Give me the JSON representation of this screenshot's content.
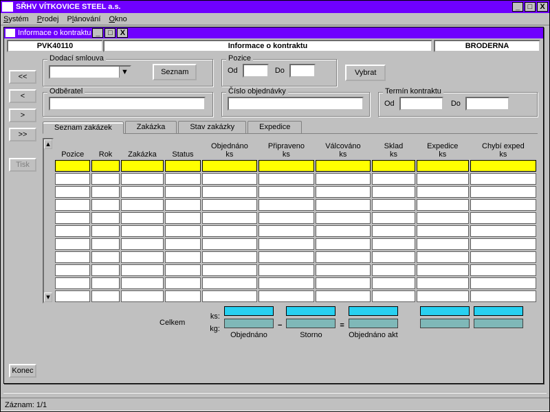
{
  "window": {
    "title": "SŘHV VÍTKOVICE STEEL a.s.",
    "menu": [
      "Systém",
      "Prodej",
      "Plánování",
      "Okno"
    ],
    "status": "Záznam: 1/1"
  },
  "internal": {
    "title": "Informace o kontraktu",
    "left_code": "PVK40110",
    "center_title": "Informace o kontraktu",
    "right_code": "BRODERNA"
  },
  "nav_buttons": [
    "<<",
    "<",
    ">",
    ">>"
  ],
  "tisk_label": "Tisk",
  "konec_label": "Konec",
  "groupboxes": {
    "dodaci": {
      "legend": "Dodací smlouva",
      "seznam_btn": "Seznam"
    },
    "pozice": {
      "legend": "Pozice",
      "od_label": "Od",
      "do_label": "Do",
      "vybrat_btn": "Vybrat"
    },
    "odberatel": {
      "legend": "Odběratel"
    },
    "objednavka": {
      "legend": "Číslo objednávky"
    },
    "termin": {
      "legend": "Termín kontraktu",
      "od_label": "Od",
      "do_label": "Do"
    }
  },
  "tabs": [
    "Seznam zakázek",
    "Zakázka",
    "Stav zakázky",
    "Expedice"
  ],
  "table": {
    "columns": [
      "Pozice",
      "Rok",
      "Zakázka",
      "Status",
      "Objednáno\nks",
      "Připraveno\nks",
      "Válcováno\nks",
      "Sklad\nks",
      "Expedice\nks",
      "Chybí exped\nks"
    ]
  },
  "totals": {
    "celkem_label": "Celkem",
    "ks_label": "ks:",
    "kg_label": "kg:",
    "col_labels": [
      "Objednáno",
      "Storno",
      "Objednáno akt"
    ]
  }
}
